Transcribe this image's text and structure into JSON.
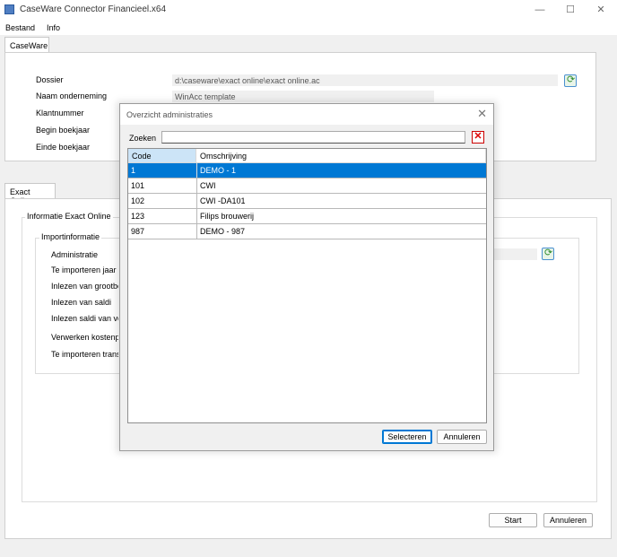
{
  "window": {
    "title": "CaseWare Connector Financieel.x64",
    "minimize": "—",
    "maximize": "☐",
    "close": "✕"
  },
  "menu": {
    "items": [
      "Bestand",
      "Info"
    ]
  },
  "caseware_tab": {
    "label": "CaseWare",
    "fields": {
      "dossier": {
        "label": "Dossier",
        "value": "d:\\caseware\\exact online\\exact online.ac"
      },
      "naam": {
        "label": "Naam onderneming",
        "value": "WinAcc template"
      },
      "klantnummer": {
        "label": "Klantnummer"
      },
      "begin": {
        "label": "Begin boekjaar"
      },
      "einde": {
        "label": "Einde boekjaar"
      }
    }
  },
  "exact_tab": {
    "label": "Exact Online",
    "info_group": "Informatie Exact Online",
    "import_group": "Importinformatie",
    "labels": [
      "Administratie",
      "Te importeren jaar",
      "Inlezen van grootboe",
      "Inlezen van saldi",
      "Inlezen saldi van vori",
      "Verwerken kostenpla",
      "Te importeren transac"
    ]
  },
  "main_buttons": {
    "start": "Start",
    "cancel": "Annuleren"
  },
  "dialog": {
    "title": "Overzicht administraties",
    "close": "✕",
    "search_label": "Zoeken",
    "search_value": "",
    "clear": "✕",
    "columns": {
      "code": "Code",
      "description": "Omschrijving"
    },
    "rows": [
      {
        "code": "1",
        "description": "DEMO - 1",
        "selected": true
      },
      {
        "code": "101",
        "description": "CWI",
        "selected": false
      },
      {
        "code": "102",
        "description": "CWI -DA101",
        "selected": false
      },
      {
        "code": "123",
        "description": "Filips brouwerij",
        "selected": false
      },
      {
        "code": "987",
        "description": "DEMO - 987",
        "selected": false
      }
    ],
    "buttons": {
      "select": "Selecteren",
      "cancel": "Annuleren"
    }
  },
  "icons": [
    "app-icon",
    "refresh-icon",
    "clear-search-icon",
    "close-icon"
  ]
}
